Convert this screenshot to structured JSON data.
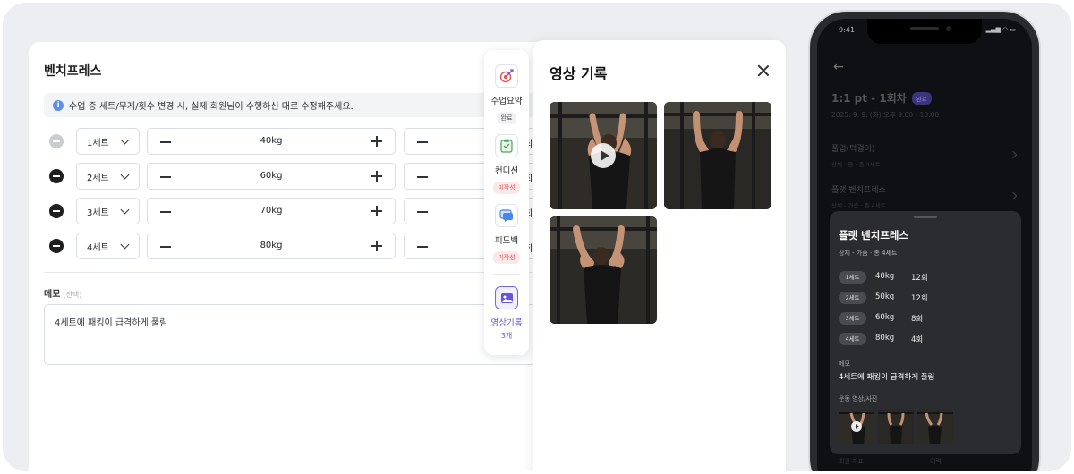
{
  "form": {
    "exercise_title": "벤치프레스",
    "notice": "수업 중 세트/무게/횟수 변경 시, 실제 회원님이 수행하신 대로 수정해주세요.",
    "info_icon_glyph": "i",
    "sets": [
      {
        "set": "1세트",
        "weight": "40kg",
        "reps_tail": "회"
      },
      {
        "set": "2세트",
        "weight": "60kg",
        "reps_tail": "회"
      },
      {
        "set": "3세트",
        "weight": "70kg",
        "reps_tail": "회"
      },
      {
        "set": "4세트",
        "weight": "80kg",
        "reps_tail": "회"
      }
    ],
    "memo_label": "메모",
    "memo_optional": "(선택)",
    "memo_value": "4세트에 패킹이 급격하게 풀림"
  },
  "rail": {
    "items": [
      {
        "label": "수업요약",
        "badge": "완료",
        "icon": "target-icon"
      },
      {
        "label": "컨디션",
        "badge": "미작성",
        "icon": "clipboard-icon"
      },
      {
        "label": "피드백",
        "badge": "미작성",
        "icon": "chat-icon"
      },
      {
        "label": "영상기록",
        "badge": "3개",
        "icon": "image-icon"
      }
    ]
  },
  "video_panel": {
    "title": "영상 기록"
  },
  "phone": {
    "status_time": "9:41",
    "status_icons": "▂▄▆ ◠ ▭",
    "back_glyph": "←",
    "session_title": "1:1 pt - 1회차",
    "session_tag": "완료",
    "session_datetime": "2025. 9. 9. (화) 오후 9:00 - 10:00",
    "exercises": [
      {
        "name": "풀업(턱걸이)",
        "sub": "상체 - 등 · 총 4세트"
      },
      {
        "name": "플랫 벤치프레스",
        "sub": "상체 - 가슴 · 총 4세트"
      }
    ],
    "sheet": {
      "title": "플랫 벤치프레스",
      "subtitle": "상체 - 가슴 · 총 4세트",
      "sets": [
        {
          "set": "1세트",
          "weight": "40kg",
          "reps": "12회"
        },
        {
          "set": "2세트",
          "weight": "50kg",
          "reps": "12회"
        },
        {
          "set": "3세트",
          "weight": "60kg",
          "reps": "8회"
        },
        {
          "set": "4세트",
          "weight": "80kg",
          "reps": "4회"
        }
      ],
      "memo_label": "메모",
      "memo_value": "4세트에 패킹이 급격하게 풀림",
      "media_label": "운동 영상/사진"
    },
    "bottom_left": "회원 지표",
    "bottom_right": "이력"
  },
  "colors": {
    "accent": "#6a55d8",
    "badge_todo": "#e25858",
    "info": "#5c8fe6"
  }
}
